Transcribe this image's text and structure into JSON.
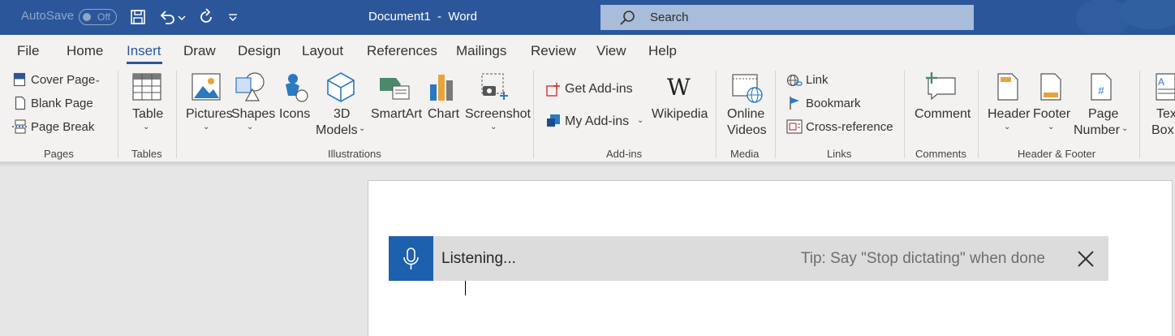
{
  "titlebar": {
    "autosave_label": "AutoSave",
    "autosave_state": "Off",
    "document_title": "Document1  -  Word",
    "search_placeholder": "Search",
    "color": "#2b579a"
  },
  "tabs": [
    {
      "label": "File"
    },
    {
      "label": "Home"
    },
    {
      "label": "Insert",
      "active": true
    },
    {
      "label": "Draw"
    },
    {
      "label": "Design"
    },
    {
      "label": "Layout"
    },
    {
      "label": "References"
    },
    {
      "label": "Mailings"
    },
    {
      "label": "Review"
    },
    {
      "label": "View"
    },
    {
      "label": "Help"
    }
  ],
  "ribbon": {
    "pages": {
      "cover_page": "Cover Page",
      "blank_page": "Blank Page",
      "page_break": "Page Break",
      "group": "Pages"
    },
    "tables": {
      "table": "Table",
      "group": "Tables"
    },
    "illustrations": {
      "pictures": "Pictures",
      "shapes": "Shapes",
      "icons": "Icons",
      "models_line1": "3D",
      "models_line2": "Models",
      "smartart": "SmartArt",
      "chart": "Chart",
      "screenshot": "Screenshot",
      "group": "Illustrations"
    },
    "addins": {
      "get_addins": "Get Add-ins",
      "my_addins": "My Add-ins",
      "wikipedia": "Wikipedia",
      "group": "Add-ins"
    },
    "media": {
      "online_line1": "Online",
      "online_line2": "Videos",
      "group": "Media"
    },
    "links": {
      "link": "Link",
      "bookmark": "Bookmark",
      "cross_reference": "Cross-reference",
      "group": "Links"
    },
    "comments": {
      "comment": "Comment",
      "group": "Comments"
    },
    "header_footer": {
      "header": "Header",
      "footer": "Footer",
      "page_line1": "Page",
      "page_line2": "Number",
      "group": "Header & Footer"
    },
    "text": {
      "textbox_line1": "Text",
      "textbox_line2": "Box"
    }
  },
  "dictation": {
    "status": "Listening...",
    "tip": "Tip: Say \"Stop dictating\" when done",
    "accent": "#1d60ad"
  },
  "icons": [
    "save-icon",
    "undo-icon",
    "redo-icon",
    "customize-icon",
    "search-icon",
    "microphone-icon",
    "close-icon"
  ]
}
